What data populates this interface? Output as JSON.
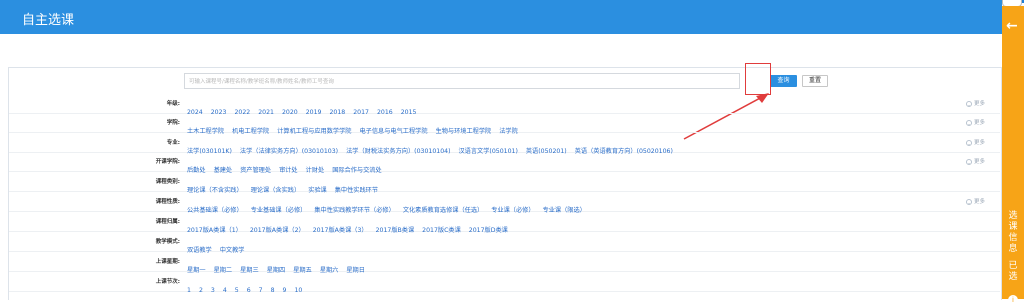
{
  "header": {
    "title": "自主选课"
  },
  "search": {
    "placeholder": "可输入课程号/课程名称/教学班名称/教师姓名/教师工号查询",
    "search_label": "查询",
    "reset_label": "重置"
  },
  "filters": [
    {
      "label": "年级:",
      "options": [
        "2024",
        "2023",
        "2022",
        "2021",
        "2020",
        "2019",
        "2018",
        "2017",
        "2016",
        "2015"
      ],
      "more": "更多"
    },
    {
      "label": "学院:",
      "options": [
        "土木工程学院",
        "机电工程学院",
        "计算机工程与应用数学学院",
        "电子信息与电气工程学院",
        "生物与环境工程学院",
        "法学院"
      ],
      "more": "更多"
    },
    {
      "label": "专业:",
      "options": [
        "法学(030101K)",
        "法学（法律实务方向）(03010103)",
        "法学（财税法实务方向）(03010104)",
        "汉语言文学(050101)",
        "英语(050201)",
        "英语（英语教育方向）(05020106)"
      ],
      "more": "更多"
    },
    {
      "label": "开课学院:",
      "options": [
        "后勤处",
        "基建处",
        "资产管理处",
        "审计处",
        "计财处",
        "国际合作与交流处"
      ],
      "more": "更多"
    },
    {
      "label": "课程类别:",
      "options": [
        "理论课（不含实践）",
        "理论课（含实践）",
        "实验课",
        "集中性实践环节"
      ],
      "more": ""
    },
    {
      "label": "课程性质:",
      "options": [
        "公共基础课（必修）",
        "专业基础课（必修）",
        "集中性实践教学环节（必修）",
        "文化素质教育选修课（任选）",
        "专业课（必修）",
        "专业课（限选）"
      ],
      "more": "更多"
    },
    {
      "label": "课程归属:",
      "options": [
        "2017版A类课（1）",
        "2017版A类课（2）",
        "2017版A类课（3）",
        "2017版B类课",
        "2017版C类课",
        "2017版D类课"
      ],
      "more": ""
    },
    {
      "label": "教学模式:",
      "options": [
        "双语教学",
        "中文教学"
      ],
      "more": ""
    },
    {
      "label": "上课星期:",
      "options": [
        "星期一",
        "星期二",
        "星期三",
        "星期四",
        "星期五",
        "星期六",
        "星期日"
      ],
      "more": ""
    },
    {
      "label": "上课节次:",
      "options": [
        "1",
        "2",
        "3",
        "4",
        "5",
        "6",
        "7",
        "8",
        "9",
        "10"
      ],
      "more": ""
    }
  ],
  "sidebar": {
    "selected_info": "选课信息",
    "selected": "已选"
  },
  "colors": {
    "primary": "#2b8fe0",
    "sidebar": "#f7a417",
    "link": "#2b6ec9",
    "annotation": "#e03c3c"
  }
}
